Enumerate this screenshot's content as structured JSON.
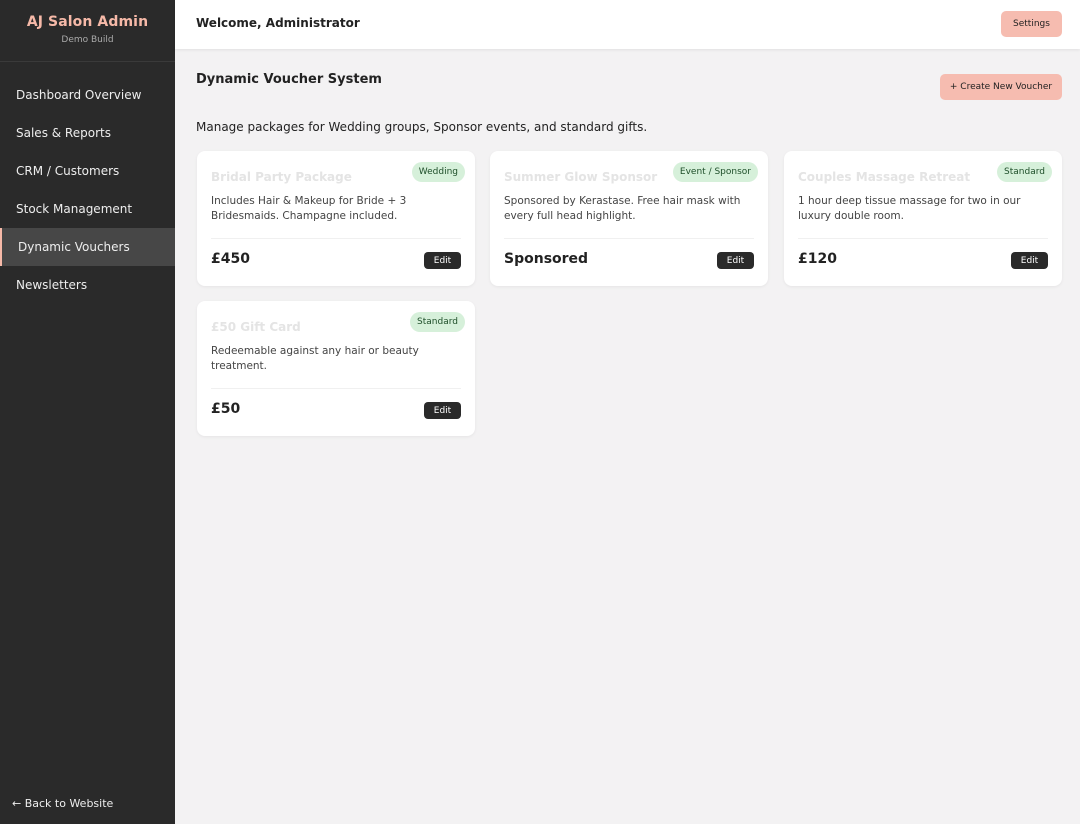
{
  "sidebar": {
    "brand_title": "AJ Salon Admin",
    "brand_subtitle": "Demo Build",
    "items": [
      {
        "label": "Dashboard Overview"
      },
      {
        "label": "Sales & Reports"
      },
      {
        "label": "CRM / Customers"
      },
      {
        "label": "Stock Management"
      },
      {
        "label": "Dynamic Vouchers",
        "active": true
      },
      {
        "label": "Newsletters"
      }
    ],
    "back_link": "← Back to Website"
  },
  "topbar": {
    "welcome": "Welcome, Administrator",
    "settings_label": "Settings"
  },
  "main": {
    "title": "Dynamic Voucher System",
    "create_label": "+ Create New Voucher",
    "description": "Manage packages for Wedding groups, Sponsor events, and standard gifts.",
    "vouchers": [
      {
        "title": "Bridal Party Package",
        "badge": "Wedding",
        "description": "Includes Hair & Makeup for Bride + 3 Bridesmaids. Champagne included.",
        "price": "£450",
        "edit_label": "Edit"
      },
      {
        "title": "Summer Glow Sponsor",
        "badge": "Event / Sponsor",
        "description": "Sponsored by Kerastase. Free hair mask with every full head highlight.",
        "price": "Sponsored",
        "edit_label": "Edit"
      },
      {
        "title": "Couples Massage Retreat",
        "badge": "Standard",
        "description": "1 hour deep tissue massage for two in our luxury double room.",
        "price": "£120",
        "edit_label": "Edit"
      },
      {
        "title": "£50 Gift Card",
        "badge": "Standard",
        "description": "Redeemable against any hair or beauty treatment.",
        "price": "£50",
        "edit_label": "Edit"
      }
    ]
  },
  "colors": {
    "sidebar_bg": "#2a2a2a",
    "accent": "#f6b9a8",
    "badge_bg": "#d6f0da",
    "page_bg": "#f3f2f3"
  }
}
